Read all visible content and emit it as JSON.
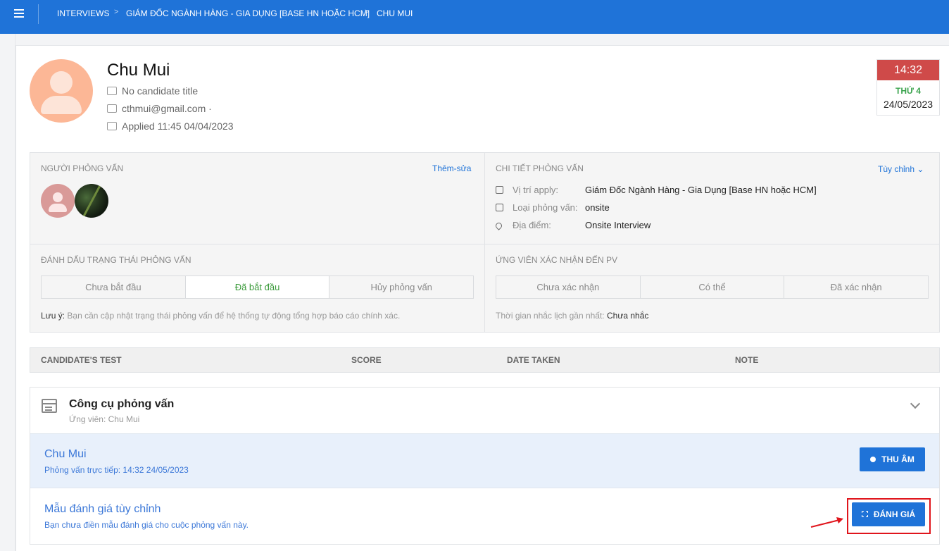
{
  "breadcrumb": {
    "items": [
      "INTERVIEWS",
      "GIÁM ĐỐC NGÀNH HÀNG - GIA DỤNG [BASE HN HOẶC HCM]",
      "CHU MUI"
    ]
  },
  "candidate": {
    "name": "Chu Mui",
    "title": "No candidate title",
    "email": "cthmui@gmail.com ·",
    "applied": "Applied 11:45 04/04/2023"
  },
  "schedule": {
    "time": "14:32",
    "weekday": "THỨ 4",
    "date": "24/05/2023"
  },
  "interviewers": {
    "title": "NGƯỜI PHỎNG VẤN",
    "edit_link": "Thêm-sửa"
  },
  "details": {
    "title": "CHI TIẾT PHỎNG VẤN",
    "customize_link": "Tùy chỉnh",
    "rows": [
      {
        "icon": "document-icon",
        "label": "Vị trí apply:",
        "value": "Giám Đốc Ngành Hàng - Gia Dụng [Base HN hoặc HCM]"
      },
      {
        "icon": "checkbox-icon",
        "label": "Loại phỏng vấn:",
        "value": "onsite"
      },
      {
        "icon": "location-pin-icon",
        "label": "Địa điểm:",
        "value": "Onsite Interview"
      }
    ]
  },
  "status": {
    "title": "ĐÁNH DẤU TRẠNG THÁI PHỎNG VẤN",
    "options": [
      "Chưa bắt đầu",
      "Đã bắt đầu",
      "Hủy phỏng vấn"
    ],
    "selected": "Đã bắt đầu",
    "note_prefix": "Lưu ý:",
    "note_text": " Bạn cần cập nhật trạng thái phỏng vấn để hệ thống tự động tổng hợp báo cáo chính xác."
  },
  "confirmation": {
    "title": "ỨNG VIÊN XÁC NHẬN ĐẾN PV",
    "options": [
      "Chưa xác nhận",
      "Có thể",
      "Đã xác nhận"
    ],
    "reminder_prefix": "Thời gian nhắc lịch gần nhất:",
    "reminder_value": " Chưa nhắc"
  },
  "test_table": {
    "columns": [
      "CANDIDATE'S TEST",
      "SCORE",
      "DATE TAKEN",
      "NOTE"
    ]
  },
  "tools": {
    "title": "Công cụ phỏng vấn",
    "subtitle": "Ứng viên: Chu Mui",
    "session_name": "Chu Mui",
    "session_info": "Phỏng vấn trực tiếp: 14:32 24/05/2023",
    "record_button": "THU ÂM",
    "eval_title": "Mẫu đánh giá tùy chỉnh",
    "eval_sub": "Bạn chưa điền mẫu đánh giá cho cuộc phỏng vấn này.",
    "eval_button": "ĐÁNH GIÁ"
  },
  "colors": {
    "brand": "#1f73d8",
    "time_badge": "#cf4a49",
    "weekday": "#3aa34d",
    "highlight": "#e0151c"
  }
}
